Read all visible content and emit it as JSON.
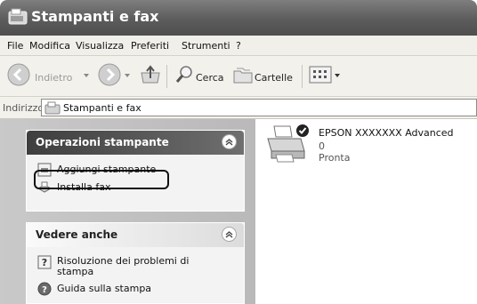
{
  "window": {
    "title": "Stampanti e fax"
  },
  "menu": {
    "items": [
      "File",
      "Modifica",
      "Visualizza",
      "Preferiti",
      "Strumenti",
      "?"
    ]
  },
  "toolbar": {
    "back_label": "Indietro",
    "search_label": "Cerca",
    "folders_label": "Cartelle"
  },
  "address": {
    "label": "Indirizzo",
    "value": "Stampanti e fax"
  },
  "tasks": {
    "title": "Operazioni stampante",
    "items": [
      {
        "label": "Aggiungi stampante"
      },
      {
        "label": "Installa fax"
      }
    ]
  },
  "see_also": {
    "title": "Vedere anche",
    "items": [
      {
        "label": "Risoluzione dei problemi di stampa"
      },
      {
        "label": "Guida sulla stampa"
      }
    ]
  },
  "printer": {
    "name": "EPSON XXXXXXX Advanced",
    "documents": "0",
    "status": "Pronta"
  },
  "colors": {
    "title_bar": "#5c5c5c",
    "task_header": "#3e3e3e",
    "pane_bg": "#c0c0c0"
  }
}
